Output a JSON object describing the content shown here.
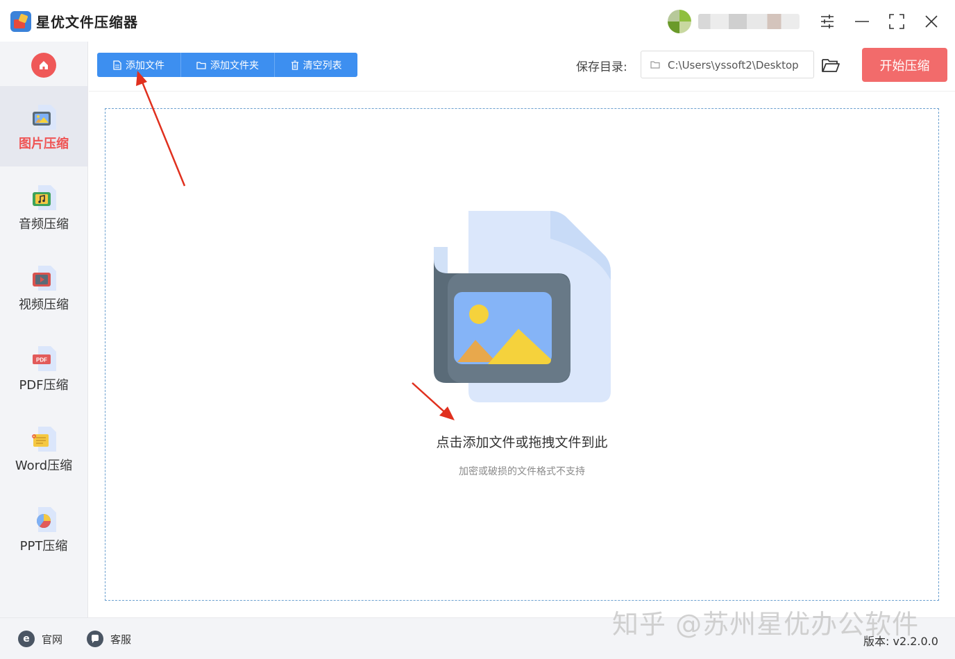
{
  "app": {
    "title": "星优文件压缩器",
    "user_name": ""
  },
  "colors": {
    "accent_blue": "#3d8ff0",
    "accent_red": "#f26b6b",
    "active_red": "#ef5454"
  },
  "sidebar": {
    "items": [
      {
        "label": "图片压缩",
        "icon": "image-file-icon",
        "active": true
      },
      {
        "label": "音频压缩",
        "icon": "audio-file-icon",
        "active": false
      },
      {
        "label": "视频压缩",
        "icon": "video-file-icon",
        "active": false
      },
      {
        "label": "PDF压缩",
        "icon": "pdf-file-icon",
        "active": false
      },
      {
        "label": "Word压缩",
        "icon": "word-file-icon",
        "active": false
      },
      {
        "label": "PPT压缩",
        "icon": "ppt-file-icon",
        "active": false
      }
    ]
  },
  "toolbar": {
    "add_file": "添加文件",
    "add_folder": "添加文件夹",
    "clear_list": "清空列表",
    "save_dir_label": "保存目录:",
    "save_dir_value": "C:\\Users\\yssoft2\\Desktop",
    "start": "开始压缩"
  },
  "dropzone": {
    "hint": "点击添加文件或拖拽文件到此",
    "subhint": "加密或破损的文件格式不支持"
  },
  "footer": {
    "website": "官网",
    "website_icon_glyph": "e",
    "support": "客服",
    "watermark": "知乎 @苏州星优办公软件",
    "version": "版本: v2.2.0.0"
  }
}
